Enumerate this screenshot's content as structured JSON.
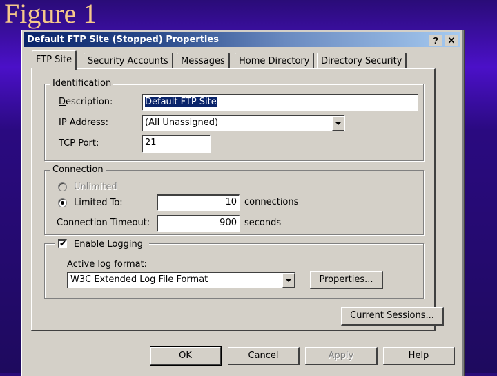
{
  "slide": {
    "title": "Figure 1"
  },
  "dialog": {
    "title": "Default FTP Site (Stopped) Properties",
    "help_button": "?",
    "close_button": "✕",
    "tabs": [
      {
        "label": "FTP Site",
        "active": true
      },
      {
        "label": "Security Accounts",
        "active": false
      },
      {
        "label": "Messages",
        "active": false
      },
      {
        "label": "Home Directory",
        "active": false
      },
      {
        "label": "Directory Security",
        "active": false
      }
    ],
    "identification": {
      "legend": "Identification",
      "description_label": "Description:",
      "description_value": "Default FTP Site",
      "ip_label": "IP Address:",
      "ip_value": "(All Unassigned)",
      "tcp_label": "TCP Port:",
      "tcp_value": "21"
    },
    "connection": {
      "legend": "Connection",
      "unlimited_label": "Unlimited",
      "limited_label": "Limited To:",
      "limited_value": "10",
      "limited_unit": "connections",
      "timeout_label": "Connection Timeout:",
      "timeout_value": "900",
      "timeout_unit": "seconds",
      "selected": "limited"
    },
    "logging": {
      "enable_label": "Enable Logging",
      "enabled": true,
      "format_label": "Active log format:",
      "format_value": "W3C Extended Log File Format",
      "properties_button": "Properties..."
    },
    "current_sessions_button": "Current Sessions...",
    "footer": {
      "ok": "OK",
      "cancel": "Cancel",
      "apply": "Apply",
      "help": "Help"
    }
  }
}
